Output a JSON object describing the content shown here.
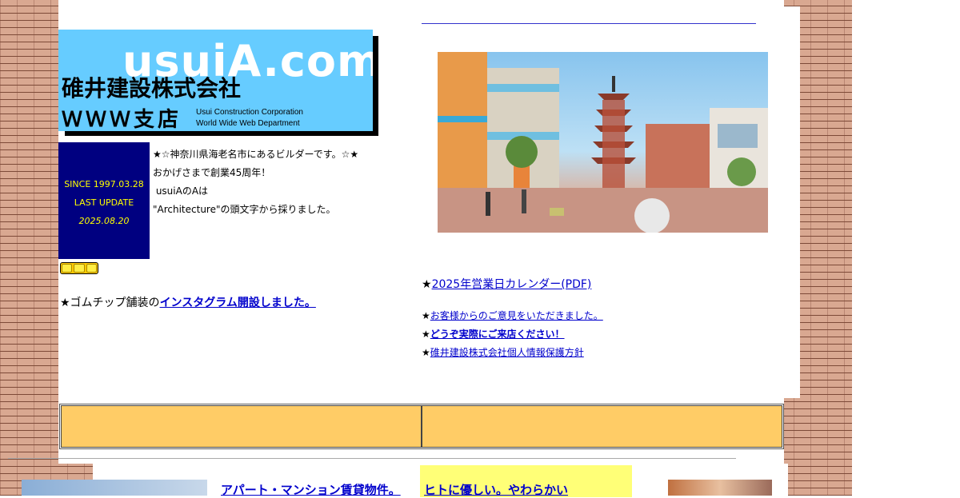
{
  "logo": {
    "domain": "usuiA.com",
    "company": "碓井建設株式会社",
    "branch": "ＷＷＷ支店",
    "english_line1": "Usui Construction Corporation",
    "english_line2": "World Wide Web Department"
  },
  "since_box": {
    "since": "SINCE 1997.03.28",
    "label": "LAST UPDATE",
    "date": "2025.08.20"
  },
  "intro": {
    "line1": "★☆神奈川県海老名市にあるビルダーです。☆★",
    "line2": "おかげさまで創業45周年！",
    "line3": " usuiAのAは",
    "line4": "\"Architecture\"の頭文字から採りました。"
  },
  "notice": {
    "prefix": "★ゴムチップ舗装の",
    "link": "インスタグラム開設しました。"
  },
  "calendar": {
    "star": "★",
    "link": "2025年営業日カレンダー(PDF)"
  },
  "links": [
    {
      "star": "★",
      "text": "お客様からのご意見をいただきました。"
    },
    {
      "star": "★",
      "text": "どうぞ実際にご来店ください！"
    },
    {
      "star": "★",
      "text": "碓井建設株式会社個人情報保護方針"
    }
  ],
  "bottom": {
    "apartment_link": "アパート・マンション賃貸物件。",
    "yellow_link": "ヒトに優しい。やわらかい"
  },
  "colors": {
    "logo_bg": "#66ccff",
    "since_bg": "#000080",
    "since_text": "#ffff00",
    "link": "#0000cc",
    "orange_cell": "#ffcc66",
    "yellow_box": "#ffff77"
  }
}
